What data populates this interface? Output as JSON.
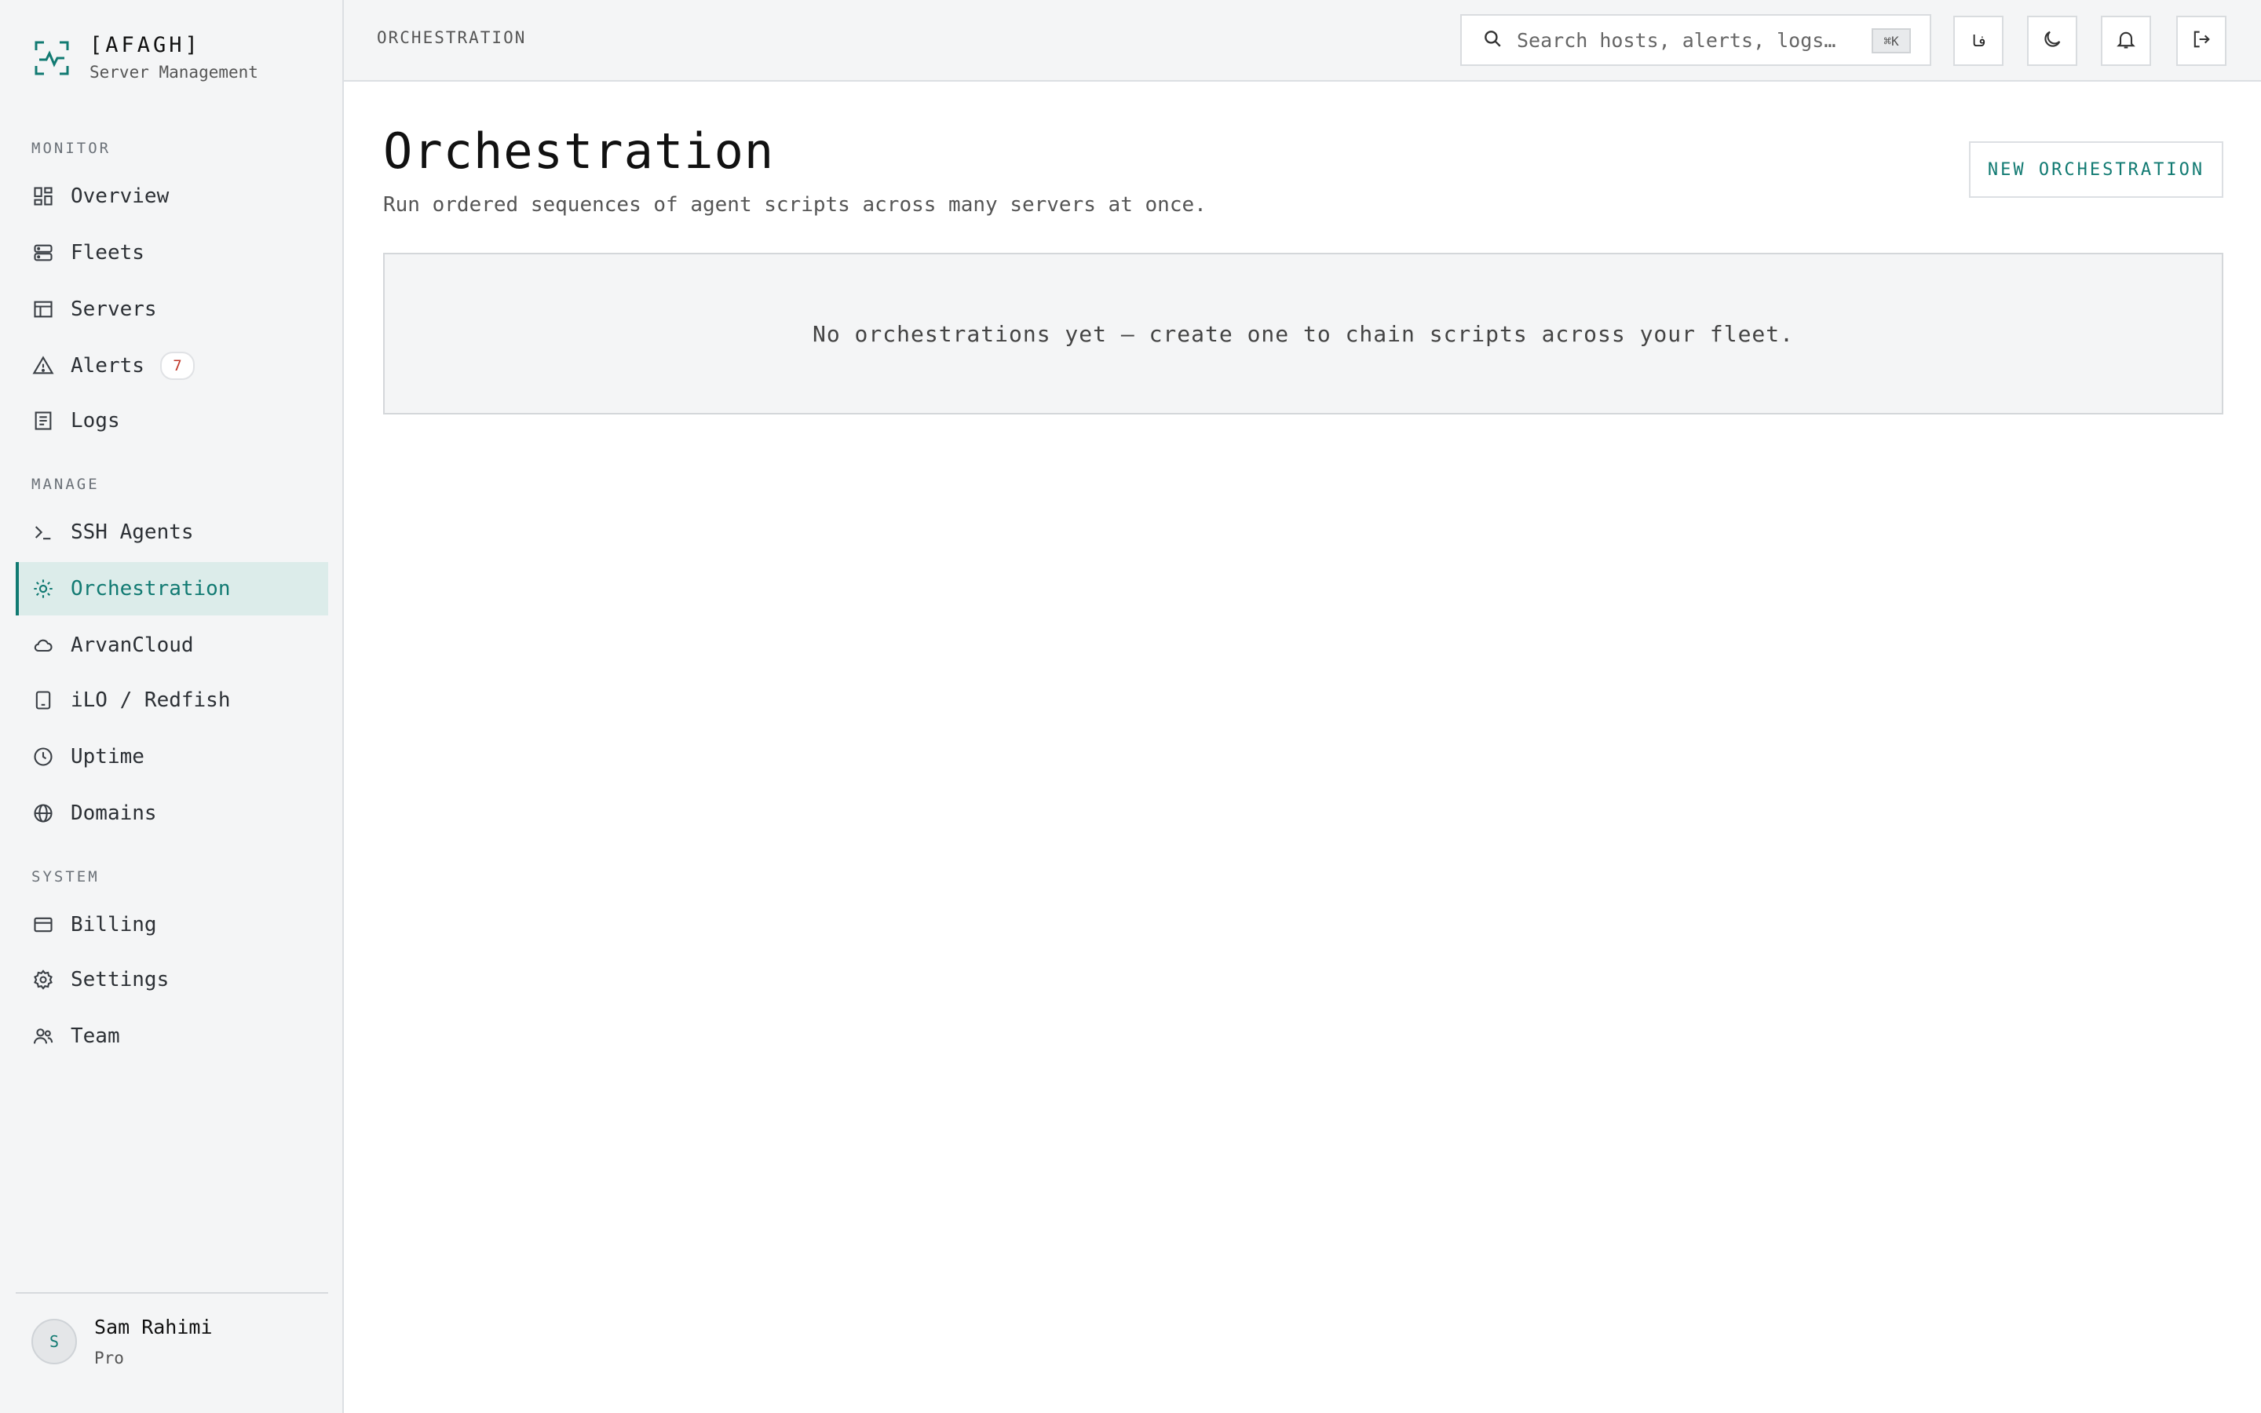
{
  "brand": {
    "name": "[AFAGH]",
    "subtitle": "Server Management"
  },
  "sidebar": {
    "sections": {
      "monitor": "MONITOR",
      "manage": "MANAGE",
      "system": "SYSTEM"
    },
    "items": [
      {
        "label": "Overview",
        "icon": "grid-icon"
      },
      {
        "label": "Fleets",
        "icon": "server-stack-icon"
      },
      {
        "label": "Servers",
        "icon": "table-icon"
      },
      {
        "label": "Alerts",
        "icon": "warning-triangle-icon",
        "badge": "7"
      },
      {
        "label": "Logs",
        "icon": "document-icon"
      },
      {
        "label": "SSH Agents",
        "icon": "terminal-icon"
      },
      {
        "label": "Orchestration",
        "icon": "sun-cog-icon",
        "active": true
      },
      {
        "label": "ArvanCloud",
        "icon": "cloud-icon"
      },
      {
        "label": "iLO / Redfish",
        "icon": "tablet-icon"
      },
      {
        "label": "Uptime",
        "icon": "clock-icon"
      },
      {
        "label": "Domains",
        "icon": "globe-icon"
      },
      {
        "label": "Billing",
        "icon": "credit-card-icon"
      },
      {
        "label": "Settings",
        "icon": "gear-icon"
      },
      {
        "label": "Team",
        "icon": "users-icon"
      }
    ]
  },
  "user": {
    "initial": "S",
    "name": "Sam Rahimi",
    "plan": "Pro"
  },
  "topbar": {
    "breadcrumb": "ORCHESTRATION",
    "search": {
      "placeholder": "Search hosts, alerts, logs…",
      "shortcut": "⌘K"
    },
    "lang_label": "فا"
  },
  "main": {
    "title": "Orchestration",
    "description": "Run ordered sequences of agent scripts across many servers at once.",
    "new_button": "NEW ORCHESTRATION",
    "empty_message": "No orchestrations yet — create one to chain scripts across your fleet."
  },
  "colors": {
    "accent": "#117a72",
    "active_bg": "#dcecea",
    "badge_text": "#c0392b",
    "sidebar_bg": "#f4f5f6"
  }
}
